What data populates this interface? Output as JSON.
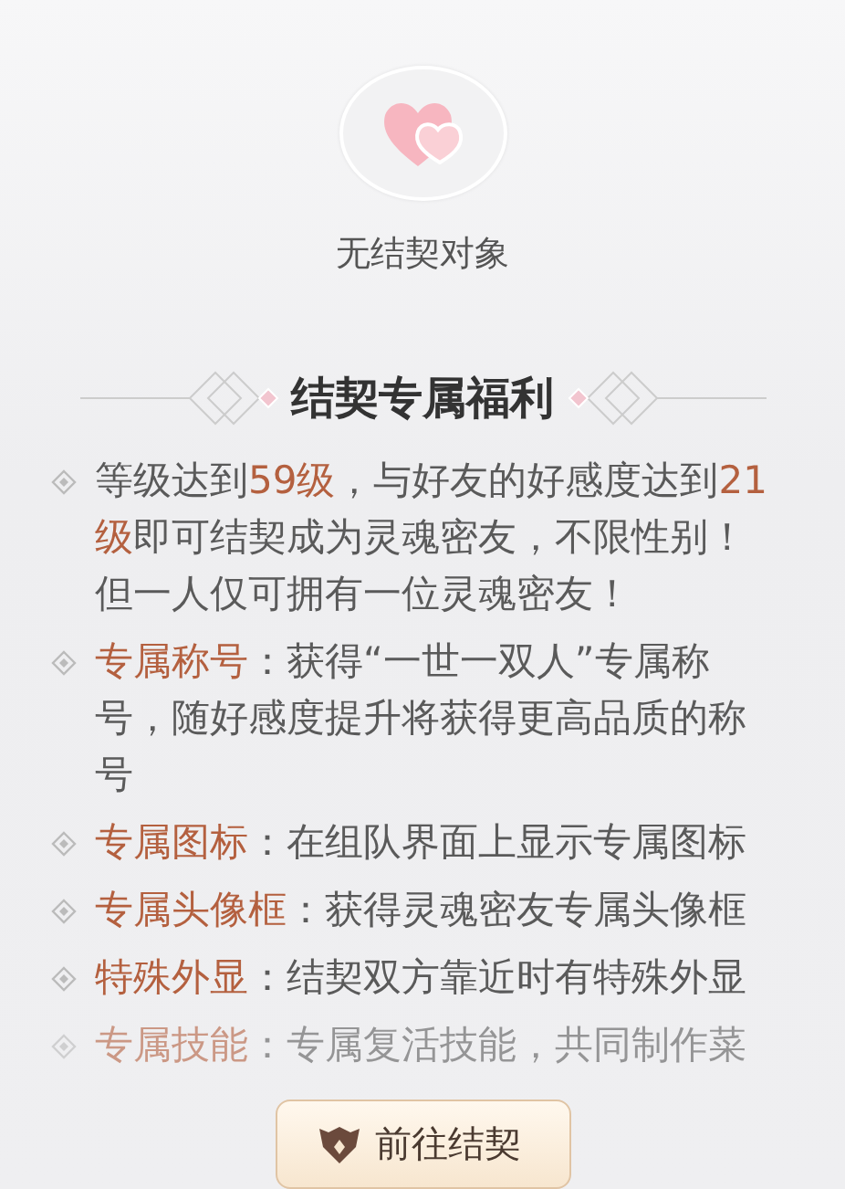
{
  "status": {
    "label": "无结契对象"
  },
  "benefits": {
    "title": "结契专属福利",
    "items": [
      {
        "faded": false,
        "parts": [
          {
            "text": "等级达到",
            "highlight": false
          },
          {
            "text": "59级",
            "highlight": true
          },
          {
            "text": "，与好友的好感度达到",
            "highlight": false
          },
          {
            "text": "21级",
            "highlight": true
          },
          {
            "text": "即可结契成为灵魂密友，不限性别！但一人仅可拥有一位灵魂密友！",
            "highlight": false
          }
        ]
      },
      {
        "faded": false,
        "parts": [
          {
            "text": "专属称号",
            "highlight": true
          },
          {
            "text": "：获得“一世一双人”专属称号，随好感度提升将获得更高品质的称号",
            "highlight": false
          }
        ]
      },
      {
        "faded": false,
        "parts": [
          {
            "text": "专属图标",
            "highlight": true
          },
          {
            "text": "：在组队界面上显示专属图标",
            "highlight": false
          }
        ]
      },
      {
        "faded": false,
        "parts": [
          {
            "text": "专属头像框",
            "highlight": true
          },
          {
            "text": "：获得灵魂密友专属头像框",
            "highlight": false
          }
        ]
      },
      {
        "faded": false,
        "parts": [
          {
            "text": "特殊外显",
            "highlight": true
          },
          {
            "text": "：结契双方靠近时有特殊外显",
            "highlight": false
          }
        ]
      },
      {
        "faded": true,
        "parts": [
          {
            "text": "专属技能",
            "highlight": true
          },
          {
            "text": "：专属复活技能，共同制作菜",
            "highlight": false
          }
        ]
      }
    ]
  },
  "button": {
    "label": "前往结契"
  }
}
